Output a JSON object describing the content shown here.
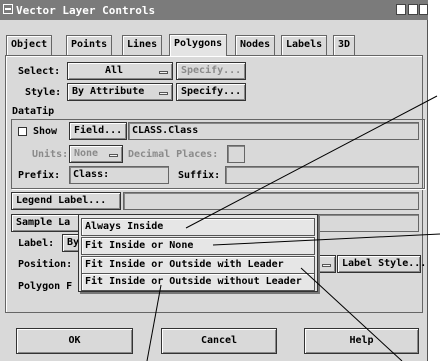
{
  "window": {
    "title": "Vector Layer Controls"
  },
  "tabs": [
    {
      "label": "Object"
    },
    {
      "label": "Points"
    },
    {
      "label": "Lines"
    },
    {
      "label": "Polygons"
    },
    {
      "label": "Nodes"
    },
    {
      "label": "Labels"
    },
    {
      "label": "3D"
    }
  ],
  "active_tab": "Polygons",
  "select": {
    "label": "Select:",
    "value": "All",
    "specify": "Specify..."
  },
  "style": {
    "label": "Style:",
    "value": "By Attribute",
    "specify": "Specify..."
  },
  "datatip": {
    "heading": "DataTip",
    "show_label": "Show",
    "field_button": "Field...",
    "field_value": "CLASS.Class",
    "units_label": "Units:",
    "units_value": "None",
    "decimal_label": "Decimal Places:",
    "prefix_label": "Prefix:",
    "prefix_value": "Class:",
    "suffix_label": "Suffix:"
  },
  "legend_label_button": "Legend Label...",
  "sample_label_button": "Sample La",
  "label_row": {
    "label": "Label:",
    "value": "By"
  },
  "position_row": {
    "label": "Position:",
    "value": "Fit Inside or Outside with Leader",
    "label_style": "Label Style..."
  },
  "polygon_row": {
    "label": "Polygon F"
  },
  "popup_items": [
    "Always Inside",
    "Fit Inside or None",
    "Fit Inside or Outside with Leader",
    "Fit Inside or Outside without Leader"
  ],
  "buttons": {
    "ok": "OK",
    "cancel": "Cancel",
    "help": "Help"
  },
  "colors": {
    "titlebar": "#7b7b7b",
    "dialog": "#d9d9d9",
    "border": "#333333"
  }
}
